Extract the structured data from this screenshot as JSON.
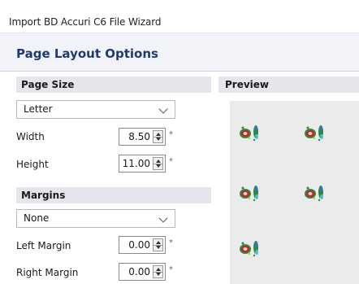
{
  "window": {
    "title": "Import BD Accuri C6 File Wizard"
  },
  "header": {
    "title": "Page Layout Options"
  },
  "page_size": {
    "section_label": "Page Size",
    "paper": "Letter",
    "width_label": "Width",
    "width_value": "8.50",
    "height_label": "Height",
    "height_value": "11.00",
    "required_marker": "*"
  },
  "margins": {
    "section_label": "Margins",
    "preset": "None",
    "left_label": "Left Margin",
    "left_value": "0.00",
    "right_label": "Right Margin",
    "right_value": "0.00",
    "required_marker": "*"
  },
  "preview": {
    "section_label": "Preview",
    "thumbnail_icon": "flow-cytometry-dotplot-icon",
    "thumbnail_count": 5
  },
  "colors": {
    "heading_blue": "#1f3a6e",
    "section_bar": "#e4e6ec",
    "paper": "#ebebeb"
  }
}
